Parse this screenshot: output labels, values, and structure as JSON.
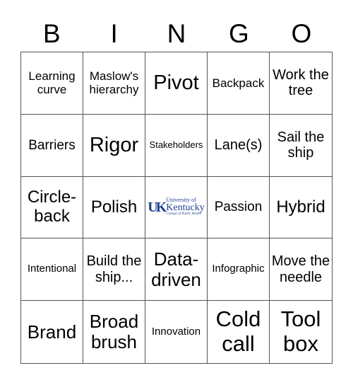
{
  "header": [
    "B",
    "I",
    "N",
    "G",
    "O"
  ],
  "cells": [
    "Learning curve",
    "Maslow's hierarchy",
    "Pivot",
    "Backpack",
    "Work the tree",
    "Barriers",
    "Rigor",
    "Stakeholders",
    "Lane(s)",
    "Sail the ship",
    "Circle-back",
    "Polish",
    "",
    "Passion",
    "Hybrid",
    "Intentional",
    "Build the ship...",
    "Data-driven",
    "Infographic",
    "Move the needle",
    "Brand",
    "Broad brush",
    "Innovation",
    "Cold call",
    "Tool box"
  ],
  "free_space": {
    "logo_mark": "UK",
    "line1": "University of",
    "line2": "Kentucky",
    "line3": "College of Public Health",
    "color": "#1f3f93"
  }
}
